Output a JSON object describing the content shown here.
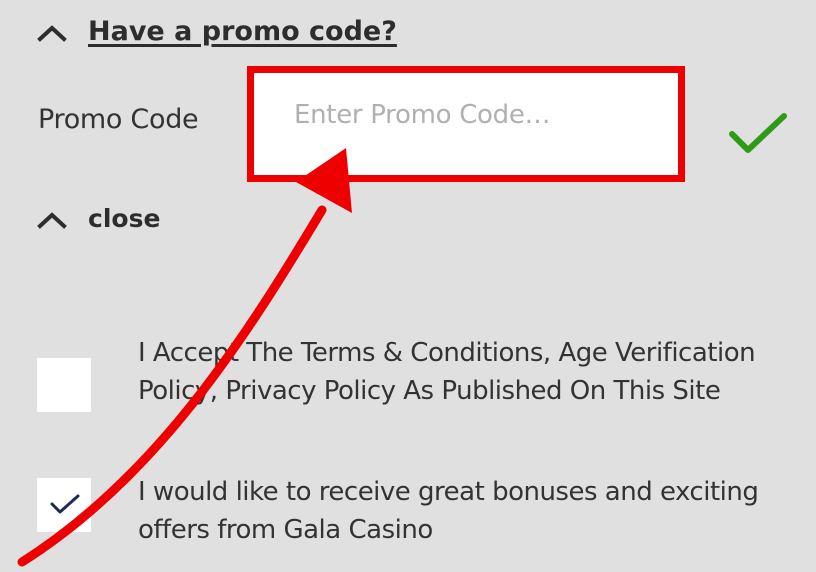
{
  "promo": {
    "toggle_label": "Have a promo code?",
    "field_label": "Promo Code",
    "input_placeholder": "Enter Promo Code…",
    "input_value": ""
  },
  "close": {
    "label": "close"
  },
  "consents": {
    "terms_text": "I Accept The Terms & Conditions, Age Verification Policy, Privacy Policy As Published On This Site",
    "terms_checked": false,
    "offers_text": "I would like to receive great bonuses and exciting offers from Gala Casino",
    "offers_checked": true
  },
  "colors": {
    "background": "#e0e0e0",
    "highlight_red": "#ee0000",
    "confirm_green": "#2e9a18",
    "checkmark_navy": "#1f2a5a"
  },
  "icons": {
    "toggle_caret": "chevron-up-icon",
    "confirm": "checkmark-icon",
    "annotation": "arrow-icon"
  }
}
